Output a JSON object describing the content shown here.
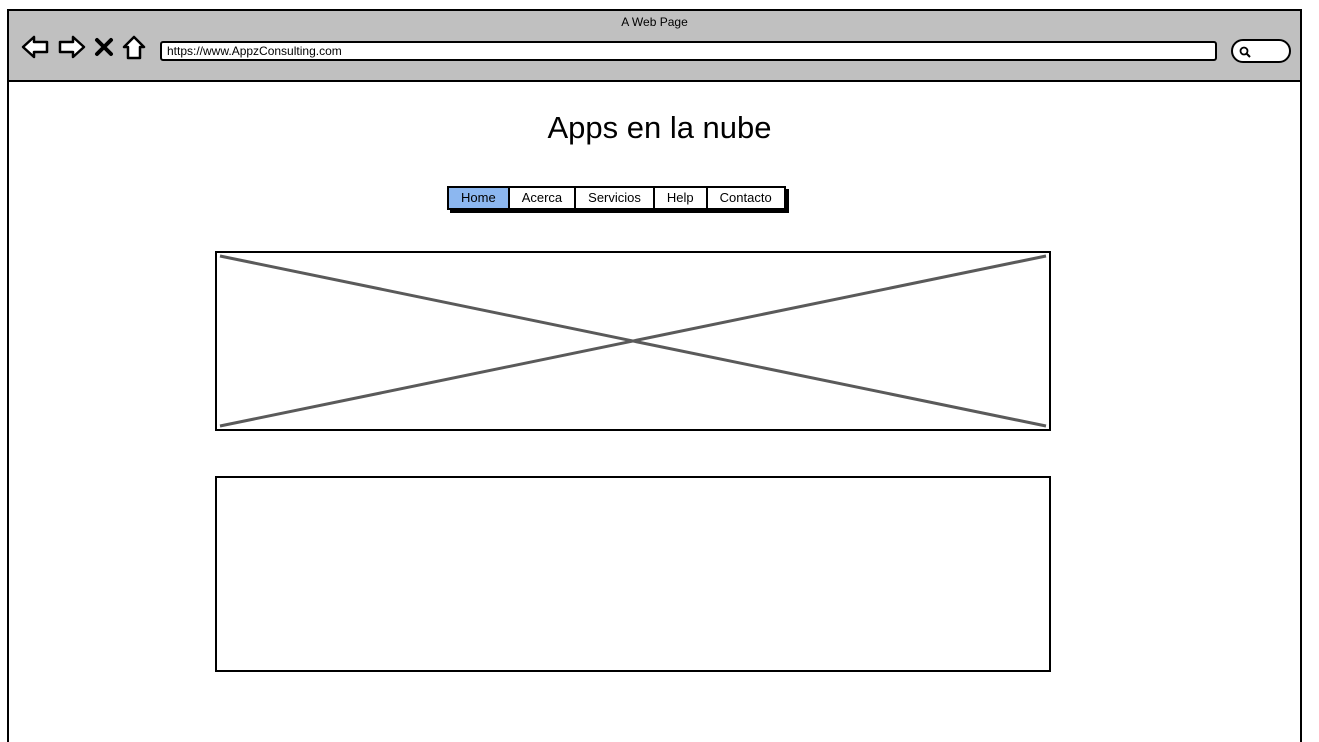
{
  "window": {
    "title": "A Web Page"
  },
  "toolbar": {
    "icons": [
      "back-icon",
      "forward-icon",
      "close-icon",
      "home-icon",
      "search-icon"
    ],
    "address": "https://www.AppzConsulting.com"
  },
  "page": {
    "title": "Apps en la nube"
  },
  "nav": {
    "tabs": [
      {
        "label": "Home",
        "active": true
      },
      {
        "label": "Acerca",
        "active": false
      },
      {
        "label": "Servicios",
        "active": false
      },
      {
        "label": "Help",
        "active": false
      },
      {
        "label": "Contacto",
        "active": false
      }
    ],
    "active_color": "#8cb7f0"
  },
  "colors": {
    "chrome": "#c0c0c0",
    "border": "#000000",
    "placeholder_cross": "#5a5a5a"
  }
}
